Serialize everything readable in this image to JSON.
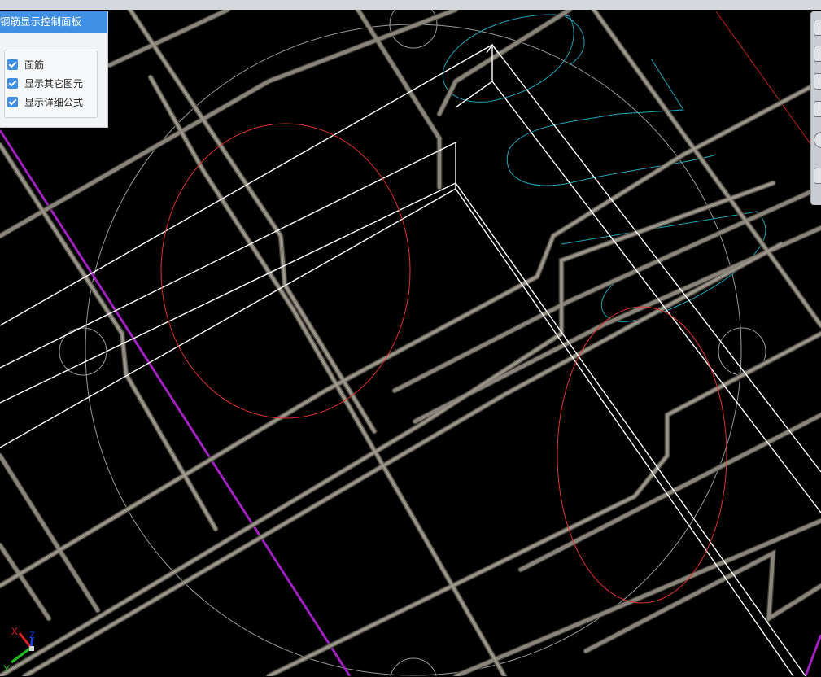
{
  "panel": {
    "title": "钢筋显示控制面板",
    "options": [
      {
        "label": "面筋",
        "checked": true
      },
      {
        "label": "显示其它图元",
        "checked": true
      },
      {
        "label": "显示详细公式",
        "checked": true
      }
    ]
  },
  "axis": {
    "x": "X",
    "y": "Y",
    "z": "Z"
  },
  "colors": {
    "background": "#000000",
    "rebar": "#8a857a",
    "outline": "#ffffff",
    "dimension_circle": "#9a9a9a",
    "highlight_ellipse": "#e0332b",
    "boundary": "#a020c0",
    "annotation": "#1ea5b8",
    "panel_header": "#3f8fe5"
  },
  "toolstrip": {
    "icons": [
      "view-cube-icon",
      "pan-icon",
      "zoom-icon",
      "orbit-icon",
      "fit-icon",
      "grid-icon"
    ]
  }
}
